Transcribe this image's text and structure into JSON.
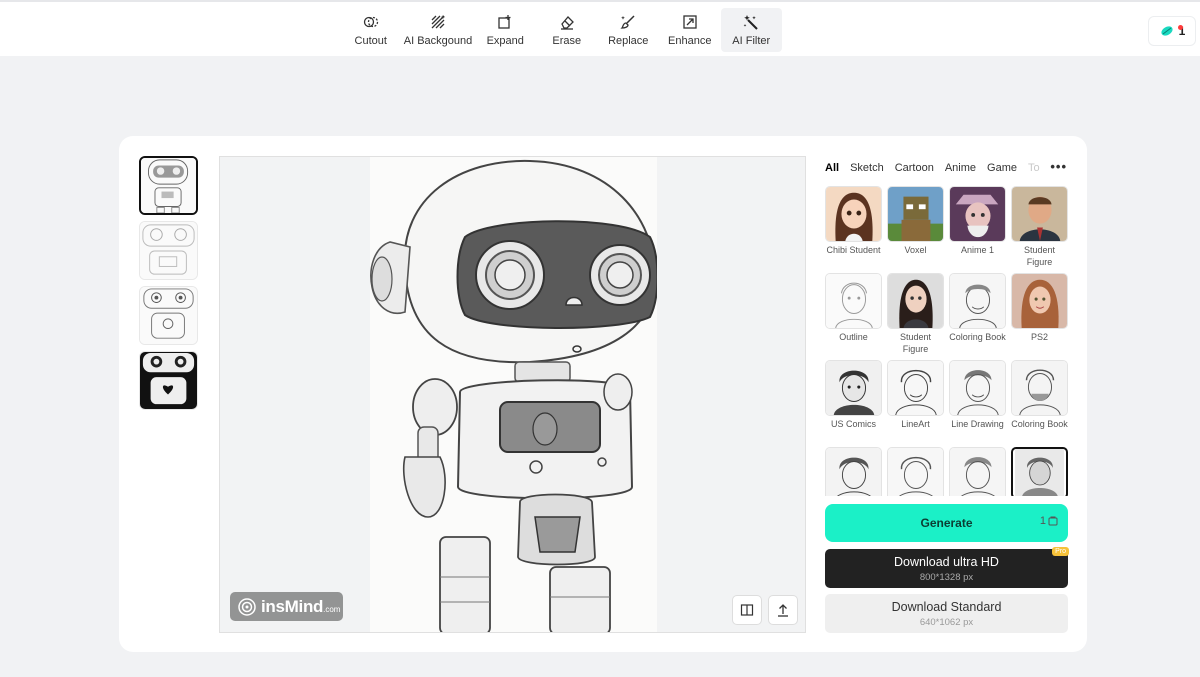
{
  "toolbar": {
    "tools": [
      {
        "label": "Cutout",
        "icon": "cutout-icon"
      },
      {
        "label": "AI Backgound",
        "icon": "ai-background-icon"
      },
      {
        "label": "Expand",
        "icon": "expand-icon"
      },
      {
        "label": "Erase",
        "icon": "eraser-icon"
      },
      {
        "label": "Replace",
        "icon": "brush-icon"
      },
      {
        "label": "Enhance",
        "icon": "enhance-icon"
      },
      {
        "label": "AI Filter",
        "icon": "magic-wand-icon",
        "active": true
      }
    ],
    "credits": "1",
    "credit_icon": "credit-leaf-icon"
  },
  "results": {
    "thumbnails": [
      {
        "name": "result-1",
        "active": true
      },
      {
        "name": "result-2"
      },
      {
        "name": "result-3"
      },
      {
        "name": "result-4"
      }
    ]
  },
  "canvas": {
    "watermark_text": "insMind",
    "watermark_suffix": ".com",
    "compare_icon": "compare-split-icon",
    "share_icon": "upload-icon"
  },
  "filters": {
    "categories": [
      "All",
      "Sketch",
      "Cartoon",
      "Anime",
      "Game",
      "To"
    ],
    "active_category": "All",
    "items": [
      {
        "label": "Chibi Student",
        "style": "color"
      },
      {
        "label": "Voxel",
        "style": "color"
      },
      {
        "label": "Anime 1",
        "style": "color"
      },
      {
        "label": "Student Figure",
        "style": "color"
      },
      {
        "label": "Outline",
        "style": "sketch"
      },
      {
        "label": "Student Figure",
        "style": "color"
      },
      {
        "label": "Coloring Book",
        "style": "sketch"
      },
      {
        "label": "PS2",
        "style": "color"
      },
      {
        "label": "US Comics",
        "style": "sketch"
      },
      {
        "label": "LineArt",
        "style": "sketch"
      },
      {
        "label": "Line Drawing",
        "style": "sketch"
      },
      {
        "label": "Coloring Book",
        "style": "sketch"
      },
      {
        "label": "",
        "style": "sketch"
      },
      {
        "label": "",
        "style": "sketch"
      },
      {
        "label": "",
        "style": "sketch"
      },
      {
        "label": "",
        "style": "sketch",
        "active": true
      }
    ]
  },
  "actions": {
    "generate_label": "Generate",
    "generate_cost": "1",
    "download_hd_label": "Download ultra HD",
    "download_hd_size": "800*1328 px",
    "pro_badge": "Pro",
    "download_std_label": "Download Standard",
    "download_std_size": "640*1062 px"
  },
  "colors": {
    "accent": "#1bf0c7",
    "dark_button": "#222222",
    "pro_badge": "#f7c23a"
  }
}
